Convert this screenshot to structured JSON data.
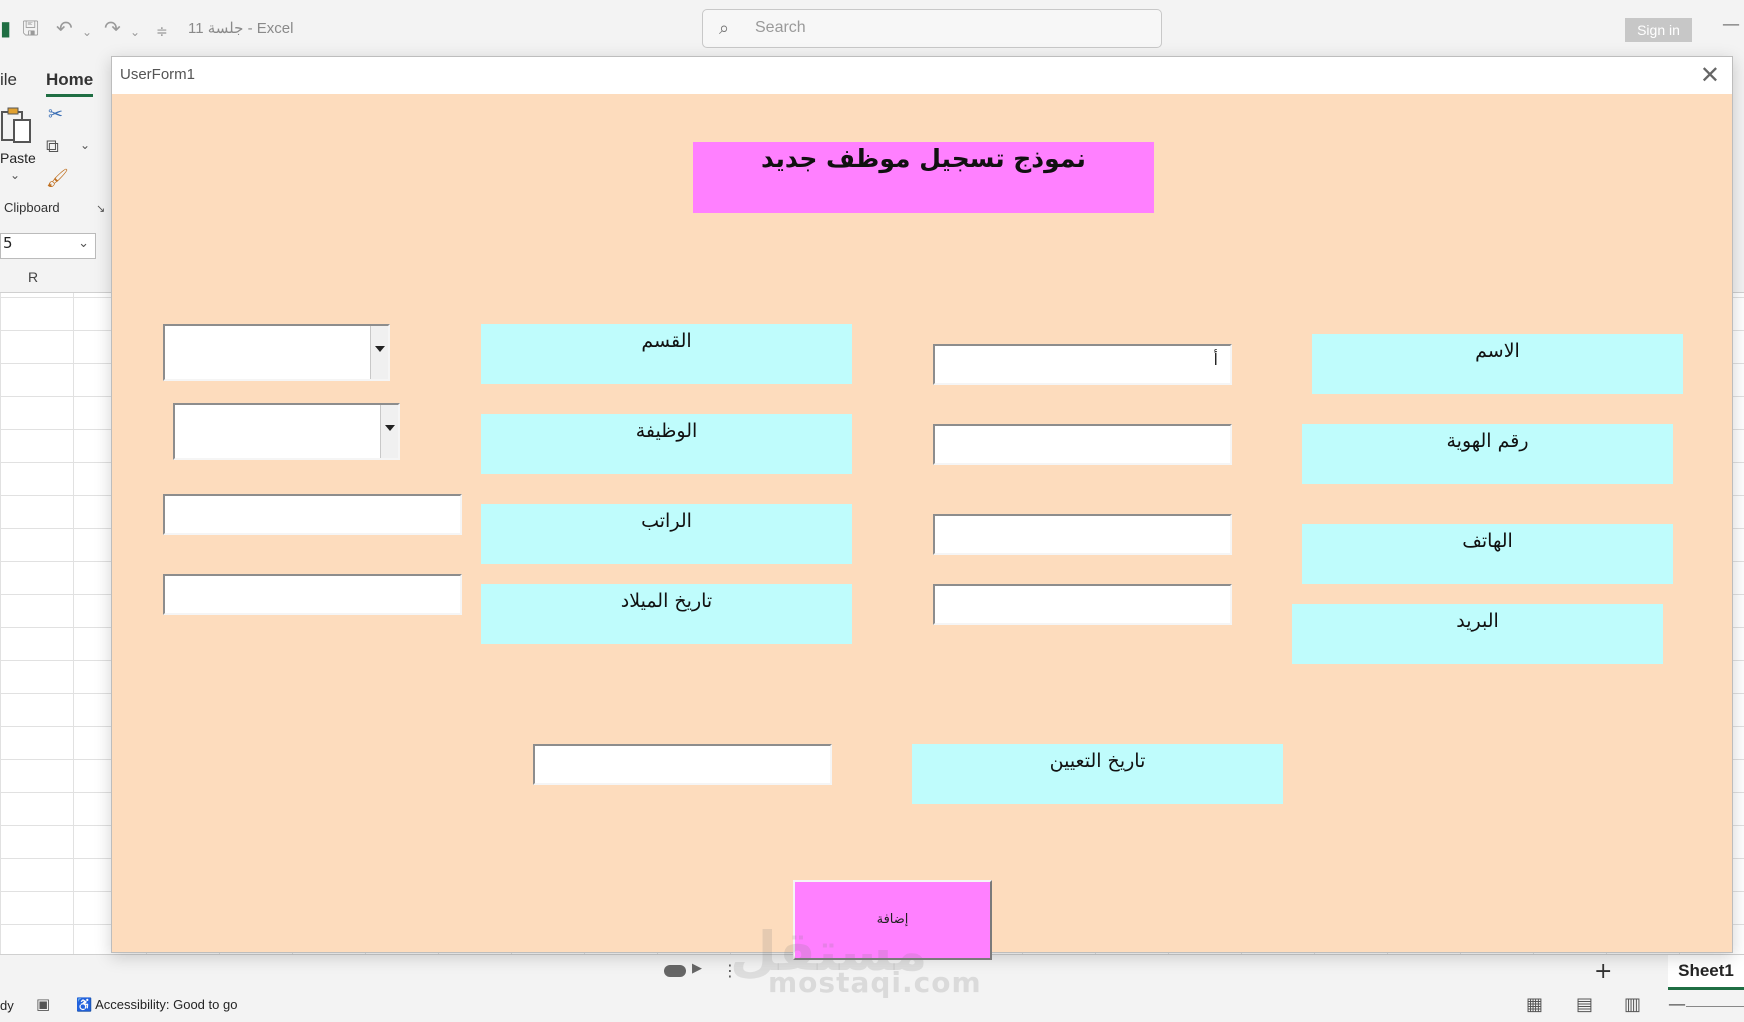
{
  "excel": {
    "doc_title": "جلسة 11  -  Excel",
    "search_placeholder": "Search",
    "sign_in_label": "Sign in",
    "tabs": {
      "file": "ile",
      "home": "Home"
    },
    "paste_label": "Paste",
    "clipboard_group": "Clipboard",
    "name_box": "5",
    "column_r": "R",
    "sheet_tab": "Sheet1",
    "status_ready": "dy",
    "accessibility": "Accessibility: Good to go"
  },
  "userform": {
    "window_title": "UserForm1",
    "form_title": "نموذج تسجيل موظف جديد",
    "labels": {
      "department": "القسم",
      "job": "الوظيفة",
      "salary": "الراتب",
      "birth_date": "تاريخ الميلاد",
      "name": "الاسم",
      "id_number": "رقم الهوية",
      "phone": "الهاتف",
      "email": "البريد",
      "hire_date": "تاريخ التعيين"
    },
    "name_value": "أ",
    "add_button": "إضافة"
  },
  "watermark": {
    "arabic": "مستقل",
    "latin": "mostaqi.com"
  }
}
